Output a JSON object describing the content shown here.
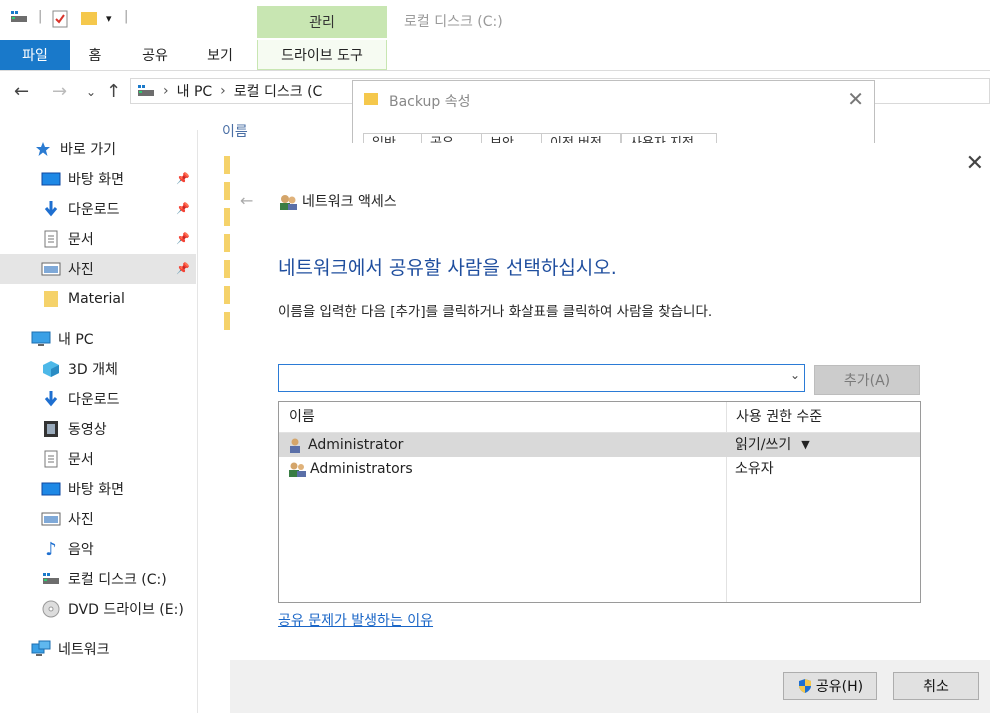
{
  "window": {
    "title": "로컬 디스크 (C:)",
    "manage_tab": "관리"
  },
  "ribbon": {
    "tabs": [
      "파일",
      "홈",
      "공유",
      "보기",
      "드라이브 도구"
    ]
  },
  "address": {
    "crumbs": [
      "내 PC",
      "로컬 디스크 (C"
    ]
  },
  "sidebar": {
    "items": [
      {
        "label": "바로 가기",
        "icon": "star-icon",
        "pinned": false
      },
      {
        "label": "바탕 화면",
        "icon": "desktop-icon",
        "pinned": true
      },
      {
        "label": "다운로드",
        "icon": "download-icon",
        "pinned": true
      },
      {
        "label": "문서",
        "icon": "document-icon",
        "pinned": true
      },
      {
        "label": "사진",
        "icon": "pictures-icon",
        "pinned": true,
        "selected": true
      },
      {
        "label": "Material",
        "icon": "folder-icon",
        "pinned": false
      },
      {
        "label": "내 PC",
        "icon": "pc-icon",
        "pinned": false
      },
      {
        "label": "3D 개체",
        "icon": "3d-objects-icon",
        "pinned": false
      },
      {
        "label": "다운로드",
        "icon": "download-icon",
        "pinned": false
      },
      {
        "label": "동영상",
        "icon": "video-icon",
        "pinned": false
      },
      {
        "label": "문서",
        "icon": "document-icon",
        "pinned": false
      },
      {
        "label": "바탕 화면",
        "icon": "desktop-icon",
        "pinned": false
      },
      {
        "label": "사진",
        "icon": "pictures-icon",
        "pinned": false
      },
      {
        "label": "음악",
        "icon": "music-icon",
        "pinned": false
      },
      {
        "label": "로컬 디스크 (C:)",
        "icon": "drive-icon",
        "pinned": false
      },
      {
        "label": "DVD 드라이브 (E:)",
        "icon": "dvd-icon",
        "pinned": false
      },
      {
        "label": "네트워크",
        "icon": "network-icon",
        "pinned": false
      }
    ]
  },
  "content": {
    "column_name": "이름"
  },
  "properties": {
    "title": "Backup 속성",
    "tabs": [
      "일반",
      "공유",
      "보안",
      "이전 버전",
      "사용자 지정"
    ]
  },
  "wizard": {
    "title": "네트워크 액세스",
    "heading": "네트워크에서 공유할 사람을 선택하십시오.",
    "description": "이름을 입력한 다음 [추가]를 클릭하거나 화살표를 클릭하여 사람을 찾습니다.",
    "name_input_value": "",
    "add_button": "추가(A)",
    "columns": {
      "name": "이름",
      "permission": "사용 권한 수준"
    },
    "users": [
      {
        "name": "Administrator",
        "permission": "읽기/쓰기",
        "selected": true
      },
      {
        "name": "Administrators",
        "permission": "소유자",
        "selected": false
      }
    ],
    "help_link": "공유 문제가 발생하는 이유",
    "share_button": "공유(H)",
    "cancel_button": "취소"
  },
  "colors": {
    "accent": "#1979ca",
    "manage_tab": "#c8e6b2",
    "heading": "#1f4e9e",
    "link": "#1a66c7"
  }
}
